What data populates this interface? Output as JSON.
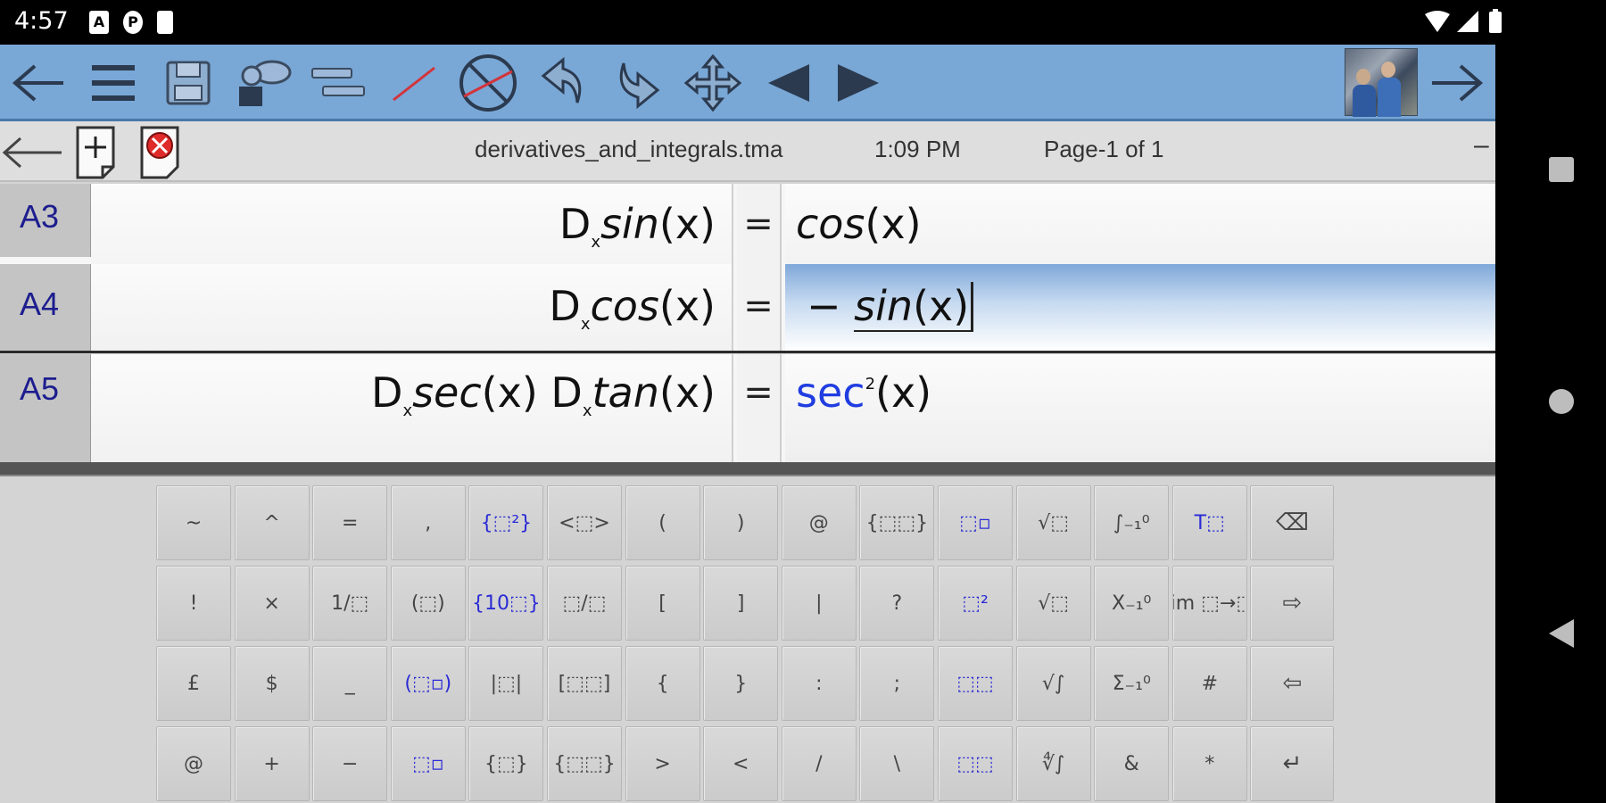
{
  "status_bar": {
    "time": "4:57",
    "icons": [
      "a-icon",
      "p-icon",
      "sd-card-icon",
      "wifi-icon",
      "signal-icon",
      "battery-icon"
    ]
  },
  "toolbar": {
    "items": [
      "back-arrow-icon",
      "menu-icon",
      "save-icon",
      "shapes-icon",
      "align-icon",
      "pen-icon",
      "no-draw-icon",
      "undo-icon",
      "redo-icon",
      "move-icon",
      "prev-icon",
      "next-icon",
      "forward-arrow-icon"
    ]
  },
  "header": {
    "filename": "derivatives_and_integrals.tma",
    "time": "1:09  PM",
    "page": "Page-1  of  1",
    "minimize": "–"
  },
  "rows": [
    {
      "label": "A3",
      "lhs": {
        "d": "D",
        "sub": "x",
        "fn": "sin",
        "arg": "(x)"
      },
      "eq": "=",
      "rhs": {
        "fn": "cos",
        "arg": "(x)"
      }
    },
    {
      "label": "A4",
      "lhs": {
        "d": "D",
        "sub": "x",
        "fn": "cos",
        "arg": "(x)"
      },
      "eq": "=",
      "rhs": {
        "neg": "−",
        "fn": "sin",
        "arg": "(x)"
      }
    },
    {
      "label": "A5",
      "lhs": {
        "d1": "D",
        "sub1": "x",
        "fn1": "sec",
        "arg1": "(x)",
        "d2": "D",
        "sub2": "x",
        "fn2": "tan",
        "arg2": "(x)"
      },
      "eq": "=",
      "rhs": {
        "fn": "sec",
        "sup": "2",
        "arg": "(x)"
      }
    }
  ],
  "keyboard": {
    "row1": [
      "~",
      "^",
      "=",
      ",",
      "{⬚²}",
      "<⬚>",
      "(",
      ")",
      "@",
      "{⬚⬚}",
      "⬚▫",
      "√⬚",
      "∫₋₁⁰",
      "T⬚",
      "⌫"
    ],
    "row2": [
      "!",
      "×",
      "1/⬚",
      "(⬚)",
      "{10⬚}",
      "⬚/⬚",
      "[",
      "]",
      "|",
      "?",
      "⬚²",
      "√⬚",
      "X₋₁⁰",
      "lim ⬚→⬚",
      "⇨"
    ],
    "row3": [
      "£",
      "$",
      "_",
      "(⬚▫)",
      "|⬚|",
      "[⬚⬚]",
      "{",
      "}",
      ":",
      ";",
      "⬚⬚",
      "√∫",
      "Σ₋₁⁰",
      "#",
      "⇦"
    ],
    "row4": [
      "@",
      "+",
      "−",
      "⬚▫",
      "{⬚}",
      "{⬚⬚}",
      ">",
      "<",
      "/",
      "\\",
      "⬚⬚",
      "∜∫",
      "&",
      "*",
      "↵"
    ]
  },
  "nav": {
    "items": [
      "square-nav-icon",
      "circle-nav-icon",
      "back-nav-icon"
    ]
  }
}
